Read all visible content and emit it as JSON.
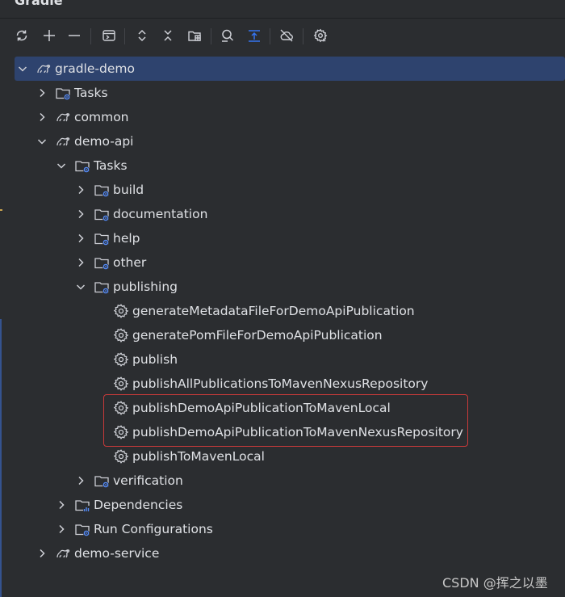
{
  "panel": {
    "title": "Gradle"
  },
  "toolbar": {
    "icons": [
      "refresh-icon",
      "plus-icon",
      "minus-icon",
      "run-task-icon",
      "expand-all-icon",
      "collapse-all-icon",
      "link-project-icon",
      "analyze-icon",
      "toggle-offline-icon",
      "offline-cloud-icon",
      "settings-gear-icon"
    ]
  },
  "tree": [
    {
      "label": "gradle-demo",
      "type": "project",
      "expanded": true,
      "selected": true
    },
    {
      "label": "Tasks",
      "type": "tasks-folder",
      "expanded": false
    },
    {
      "label": "common",
      "type": "project",
      "expanded": false
    },
    {
      "label": "demo-api",
      "type": "project",
      "expanded": true
    },
    {
      "label": "Tasks",
      "type": "tasks-folder",
      "expanded": true
    },
    {
      "label": "build",
      "type": "task-group",
      "expanded": false
    },
    {
      "label": "documentation",
      "type": "task-group",
      "expanded": false
    },
    {
      "label": "help",
      "type": "task-group",
      "expanded": false
    },
    {
      "label": "other",
      "type": "task-group",
      "expanded": false
    },
    {
      "label": "publishing",
      "type": "task-group",
      "expanded": true
    },
    {
      "label": "generateMetadataFileForDemoApiPublication",
      "type": "task"
    },
    {
      "label": "generatePomFileForDemoApiPublication",
      "type": "task"
    },
    {
      "label": "publish",
      "type": "task"
    },
    {
      "label": "publishAllPublicationsToMavenNexusRepository",
      "type": "task"
    },
    {
      "label": "publishDemoApiPublicationToMavenLocal",
      "type": "task",
      "highlighted": true
    },
    {
      "label": "publishDemoApiPublicationToMavenNexusRepository",
      "type": "task",
      "highlighted": true
    },
    {
      "label": "publishToMavenLocal",
      "type": "task"
    },
    {
      "label": "verification",
      "type": "task-group",
      "expanded": false
    },
    {
      "label": "Dependencies",
      "type": "dependencies",
      "expanded": false
    },
    {
      "label": "Run Configurations",
      "type": "run-configs",
      "expanded": false
    },
    {
      "label": "demo-service",
      "type": "project",
      "expanded": false
    }
  ],
  "watermark": "CSDN @挥之以墨"
}
